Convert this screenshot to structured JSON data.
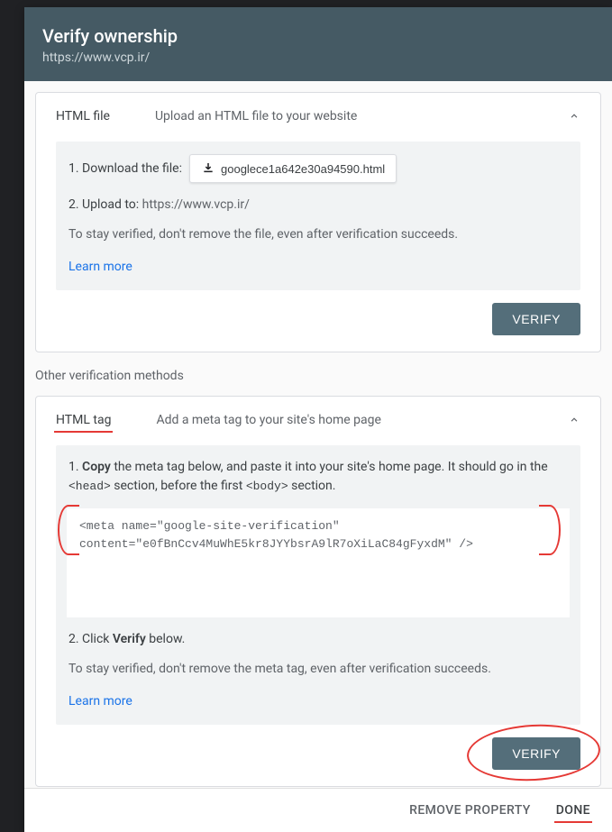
{
  "header": {
    "title": "Verify ownership",
    "url": "https://www.vcp.ir/"
  },
  "htmlFile": {
    "label": "HTML file",
    "desc": "Upload an HTML file to your website",
    "step1_prefix": "1. Download the file:",
    "download_file": "googlece1a642e30a94590.html",
    "step2_prefix": "2. Upload to: ",
    "step2_url": "https://www.vcp.ir/",
    "hint": "To stay verified, don't remove the file, even after verification succeeds.",
    "learn": "Learn more",
    "verify": "VERIFY"
  },
  "otherMethodsLabel": "Other verification methods",
  "htmlTag": {
    "label": "HTML tag",
    "desc": "Add a meta tag to your site's home page",
    "step1_a": "1. ",
    "step1_copy": "Copy",
    "step1_b": " the meta tag below, and paste it into your site's home page. It should go in the ",
    "step1_head": "<head>",
    "step1_c": " section, before the first ",
    "step1_body": "<body>",
    "step1_d": " section.",
    "code": "<meta name=\"google-site-verification\" \ncontent=\"e0fBnCcv4MuWhE5kr8JYYbsrA9lR7oXiLaC84gFyxdM\" />",
    "step2_a": "2. Click ",
    "step2_verify": "Verify",
    "step2_b": " below.",
    "hint": "To stay verified, don't remove the meta tag, even after verification succeeds.",
    "learn": "Learn more",
    "verify": "VERIFY"
  },
  "footer": {
    "remove": "REMOVE PROPERTY",
    "done": "DONE"
  }
}
